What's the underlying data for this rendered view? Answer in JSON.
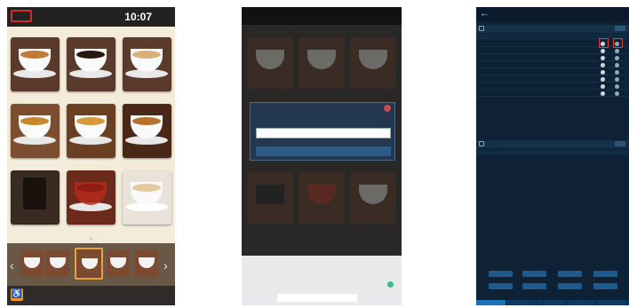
{
  "panel1": {
    "time": "10:07",
    "status_text": "",
    "version_text": "",
    "accessibility_icon": "wheelchair-icon",
    "accent_color": "#d62a2a",
    "tiles": [
      {
        "liquid": "#c27a34",
        "label": ""
      },
      {
        "liquid": "#2a160e",
        "label": ""
      },
      {
        "liquid": "#d8b07a",
        "label": ""
      },
      {
        "liquid": "#c8862e",
        "label": ""
      },
      {
        "liquid": "#d59a3a",
        "label": ""
      },
      {
        "liquid": "#b9712a",
        "label": ""
      },
      {
        "liquid": "#1b120d",
        "label": ""
      },
      {
        "liquid": "#8e1b14",
        "label": ""
      },
      {
        "liquid": "#e6c89d",
        "label": ""
      }
    ],
    "carousel_count": 6
  },
  "panel2": {
    "dialog_title": "",
    "dialog_button": "",
    "input_value": ""
  },
  "panel3": {
    "title": "",
    "section1_label": "",
    "section2_label": "",
    "table_headers": [
      "",
      "",
      "",
      "",
      ""
    ],
    "rows": [
      {
        "c1": "",
        "c2": "",
        "c3": ""
      },
      {
        "c1": "",
        "c2": "",
        "c3": ""
      },
      {
        "c1": "",
        "c2": "",
        "c3": ""
      },
      {
        "c1": "",
        "c2": "",
        "c3": ""
      },
      {
        "c1": "",
        "c2": "",
        "c3": ""
      },
      {
        "c1": "",
        "c2": "",
        "c3": ""
      },
      {
        "c1": "",
        "c2": "",
        "c3": ""
      },
      {
        "c1": "",
        "c2": "",
        "c3": ""
      }
    ],
    "buttons": [
      "",
      "",
      "",
      "",
      "",
      "",
      "",
      ""
    ],
    "page_label": "",
    "title_color": "#37c24b"
  }
}
